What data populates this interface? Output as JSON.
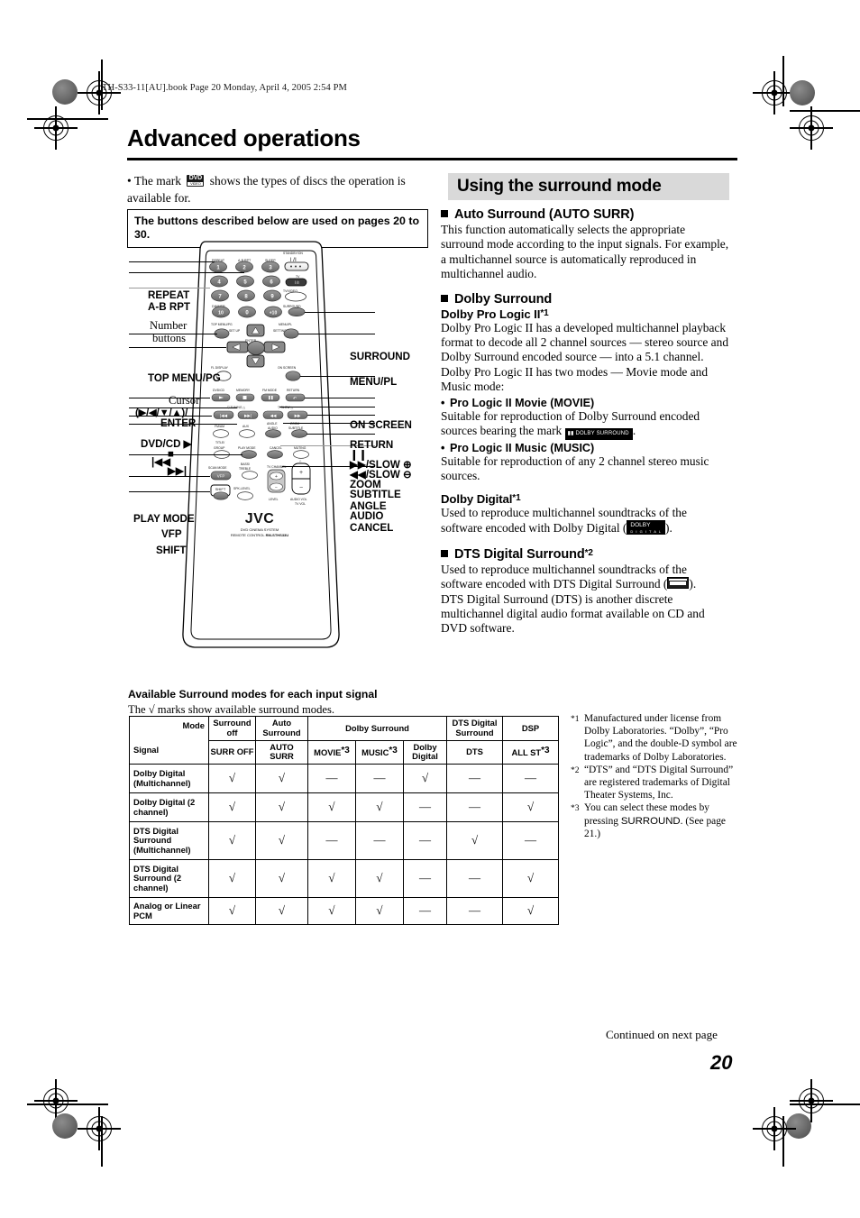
{
  "page": {
    "book_line": "TH-S33-11[AU].book  Page 20  Monday, April 4, 2005  2:54 PM",
    "title": "Advanced operations",
    "page_number": "20",
    "continued": "Continued on next page"
  },
  "left_column": {
    "mark_note_before": "• The mark",
    "mark_note_after": "shows the types of discs the operation is available for.",
    "disc_mark_top": "DVD",
    "disc_mark_bottom": "VIDEO",
    "box_note": "The buttons described below are used on pages 20 to 30."
  },
  "remote": {
    "brand": "JVC",
    "system_line": "DVD CINEMA SYSTEM",
    "model_line_prefix": "REMOTE CONTROL ",
    "model": "RM-STHS33U",
    "left_labels": [
      {
        "name": "repeat",
        "text": "REPEAT"
      },
      {
        "name": "a-b-rpt",
        "text": "A-B RPT"
      },
      {
        "name": "number-buttons-1",
        "text": "Number"
      },
      {
        "name": "number-buttons-2",
        "text": "buttons"
      },
      {
        "name": "top-menu-pg",
        "text": "TOP MENU/PG"
      },
      {
        "name": "cursor",
        "text": "Cursor"
      },
      {
        "name": "cursor-dirs",
        "text": "(▶/◀/▼/▲)/"
      },
      {
        "name": "enter",
        "text": "ENTER"
      },
      {
        "name": "dvd-cd-play",
        "text": "DVD/CD ▶"
      },
      {
        "name": "stop",
        "text": "■"
      },
      {
        "name": "prev",
        "text": "|◀◀"
      },
      {
        "name": "next",
        "text": "▶▶|"
      },
      {
        "name": "play-mode",
        "text": "PLAY MODE"
      },
      {
        "name": "vfp",
        "text": "VFP"
      },
      {
        "name": "shift",
        "text": "SHIFT"
      }
    ],
    "right_labels": [
      {
        "name": "surround",
        "text": "SURROUND"
      },
      {
        "name": "menu-pl",
        "text": "MENU/PL"
      },
      {
        "name": "on-screen",
        "text": "ON SCREEN"
      },
      {
        "name": "return",
        "text": "RETURN"
      },
      {
        "name": "pause",
        "text": "❙❙"
      },
      {
        "name": "ff-slow-plus",
        "text": "▶▶/SLOW ⊕"
      },
      {
        "name": "rew-slow-minus",
        "text": "◀◀/SLOW ⊖"
      },
      {
        "name": "zoom",
        "text": "ZOOM"
      },
      {
        "name": "subtitle",
        "text": "SUBTITLE"
      },
      {
        "name": "angle",
        "text": "ANGLE"
      },
      {
        "name": "audio",
        "text": "AUDIO"
      },
      {
        "name": "cancel",
        "text": "CANCEL"
      }
    ],
    "key_captions": {
      "standby": "STANDBY/ON",
      "tv": "TV",
      "tv_video": "TV/VIDEO",
      "surround": "SURROUND",
      "repeat": "REPEAT",
      "a_b_rpt": "A-B RPT",
      "sleep": "SLEEP",
      "dimmer": "DIMMER",
      "top_menu": "TOP MENU/PG",
      "set_up": "SET UP",
      "menu_pl": "MENU/PL",
      "setting": "SETTING",
      "enter": "ENTER",
      "fl_display": "FL DISPLAY",
      "on_screen": "ON SCREEN",
      "dvd_cd": "DVD/CD",
      "memory": "MEMORY",
      "fm_mode": "FM MODE",
      "return": "RETURN",
      "tuning": "TUNING",
      "slow": "SLOW",
      "fm_am": "FM/AM",
      "aux": "AUX",
      "angle_audio": "ANGLE AUDIO",
      "zoom_subtitle": "ZOOM SUBTITLE",
      "title_group": "TITLE/ GROUP",
      "play_mode": "PLAY MODE",
      "cancel": "CANCEL",
      "muting": "MUTING",
      "scan_mode": "SCAN MODE",
      "vfp": "VFP",
      "bass_treble": "BASS/ TREBLE",
      "tv_channel": "TV CHANNEL",
      "shift": "SHIFT",
      "spk_level": "SPK-LEVEL",
      "level": "LEVEL",
      "audio_vol": "AUDIO VOL TV VOL"
    },
    "numbers": [
      "1",
      "2",
      "3",
      "4",
      "5",
      "6",
      "7",
      "8",
      "9",
      "10",
      "0",
      "+10"
    ]
  },
  "surround_section": {
    "banner": "Using the surround mode",
    "blocks": [
      {
        "heading": "Auto Surround (AUTO SURR)",
        "level": "h2",
        "body": "This function automatically selects the appropriate surround mode according to the input signals. For example, a multichannel source is automatically reproduced in multichannel audio."
      },
      {
        "heading": "Dolby Surround",
        "level": "h2"
      },
      {
        "heading": "Dolby Pro Logic II",
        "sup": "*1",
        "level": "h3",
        "body": "Dolby Pro Logic II has a developed multichannel playback format to decode all 2 channel sources — stereo source and Dolby Surround encoded source — into a 5.1 channel.\nDolby Pro Logic II has two modes — Movie mode and Music mode:"
      },
      {
        "heading": "Pro Logic II Movie (MOVIE)",
        "level": "li",
        "body_before": "Suitable for reproduction of Dolby Surround encoded sources bearing the mark",
        "body_after": "."
      },
      {
        "heading": "Pro Logic II Music (MUSIC)",
        "level": "li",
        "body": "Suitable for reproduction of any 2 channel stereo music sources."
      },
      {
        "heading": "Dolby Digital",
        "sup": "*1",
        "level": "h3",
        "body_before": "Used to reproduce multichannel soundtracks of the software encoded with Dolby Digital (",
        "body_after": ")."
      },
      {
        "heading": "DTS Digital Surround",
        "sup": "*2",
        "level": "h2",
        "body_before": "Used to reproduce multichannel soundtracks of the software encoded with DTS Digital Surround (",
        "body_after": ").",
        "body2": "DTS Digital Surround (DTS) is another discrete multichannel digital audio format available on CD and DVD software."
      }
    ],
    "logos": {
      "dolby_surround": "DOLBY SURROUND",
      "dolby_digital": "DOLBY",
      "dolby_digital_sub": "D I G I T A L"
    }
  },
  "table_section": {
    "heading": "Available Surround modes for each input signal",
    "subheading": "The √ marks show available surround modes.",
    "corner_mode": "Mode",
    "corner_signal": "Signal",
    "group_headers": [
      {
        "label": "Surround off",
        "span": 1
      },
      {
        "label": "Auto Surround",
        "span": 1
      },
      {
        "label": "Dolby Surround",
        "span": 3
      },
      {
        "label": "DTS Digital Surround",
        "span": 1
      },
      {
        "label": "DSP",
        "span": 1
      }
    ],
    "sub_headers": [
      {
        "label": "SURR OFF",
        "sup": ""
      },
      {
        "label": "AUTO SURR",
        "sup": ""
      },
      {
        "label": "MOVIE",
        "sup": "*3"
      },
      {
        "label": "MUSIC",
        "sup": "*3"
      },
      {
        "label": "Dolby Digital",
        "sup": ""
      },
      {
        "label": "DTS",
        "sup": ""
      },
      {
        "label": "ALL ST",
        "sup": "*3"
      }
    ],
    "rows": [
      {
        "signal": "Dolby Digital (Multichannel)",
        "cells": [
          "√",
          "√",
          "—",
          "—",
          "√",
          "—",
          "—"
        ]
      },
      {
        "signal": "Dolby Digital (2 channel)",
        "cells": [
          "√",
          "√",
          "√",
          "√",
          "—",
          "—",
          "√"
        ]
      },
      {
        "signal": "DTS Digital Surround (Multichannel)",
        "cells": [
          "√",
          "√",
          "—",
          "—",
          "—",
          "√",
          "—"
        ]
      },
      {
        "signal": "DTS Digital Surround (2 channel)",
        "cells": [
          "√",
          "√",
          "√",
          "√",
          "—",
          "—",
          "√"
        ]
      },
      {
        "signal": "Analog or Linear PCM",
        "cells": [
          "√",
          "√",
          "√",
          "√",
          "—",
          "—",
          "√"
        ]
      }
    ]
  },
  "footnotes": [
    {
      "mark": "*1",
      "text": "Manufactured under license from Dolby Laboratories. “Dolby”, “Pro Logic”, and the double-D symbol are trademarks of Dolby Laboratories."
    },
    {
      "mark": "*2",
      "text": "“DTS” and “DTS Digital Surround” are registered trademarks of Digital Theater Systems, Inc."
    },
    {
      "mark": "*3",
      "text_before": "You can select these modes by pressing ",
      "keyword": "SURROUND",
      "text_after": ". (See page 21.)"
    }
  ]
}
